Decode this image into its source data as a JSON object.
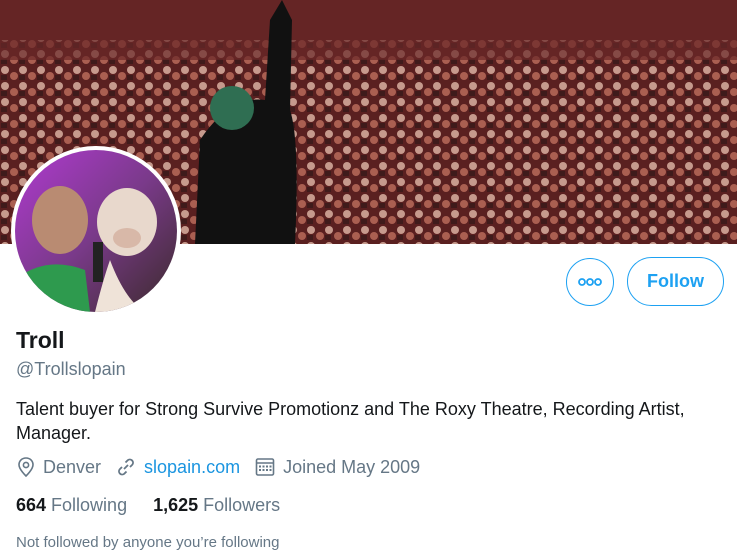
{
  "banner": {
    "image": "concert-crowd-photo"
  },
  "avatar": {
    "image": "man-with-dog-photo"
  },
  "actions": {
    "more_icon": "more-dots-icon",
    "follow_label": "Follow"
  },
  "profile": {
    "name": "Troll",
    "handle": "@Trollslopain",
    "bio": "Talent buyer for Strong Survive Promotionz and The Roxy Theatre, Recording Artist, Manager.",
    "location": "Denver",
    "website": "slopain.com",
    "joined": "Joined May 2009"
  },
  "stats": {
    "following_count": "664",
    "following_label": "Following",
    "followers_count": "1,625",
    "followers_label": "Followers"
  },
  "note": "Not followed by anyone you’re following",
  "colors": {
    "accent": "#1da1f2",
    "link": "#1b95e0",
    "secondary_text": "#657786",
    "primary_text": "#14171a"
  }
}
